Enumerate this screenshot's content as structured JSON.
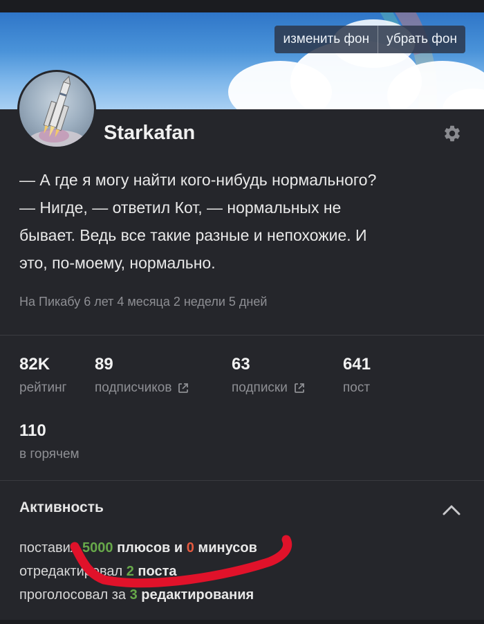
{
  "banner": {
    "change_bg_label": "изменить фон",
    "remove_bg_label": "убрать фон"
  },
  "profile": {
    "username": "Starkafan",
    "bio_lines": [
      "— А где я могу найти кого-нибудь нормального?",
      "— Нигде, — ответил Кот, — нормальных не",
      "бывает. Ведь все такие разные и непохожие. И",
      "это, по-моему, нормально."
    ],
    "member_since": "На Пикабу 6 лет 4 месяца 2 недели 5 дней"
  },
  "stats": [
    {
      "value": "82K",
      "label": "рейтинг"
    },
    {
      "value": "89",
      "label": "подписчиков"
    },
    {
      "value": "63",
      "label": "подписки"
    },
    {
      "value": "641",
      "label": "пост"
    },
    {
      "value": "110",
      "label": "в горячем"
    }
  ],
  "activity": {
    "title": "Активность",
    "line1": {
      "pre": "поставил ",
      "plus_count": "5000",
      "mid": " плюсов и ",
      "minus_count": "0",
      "post": " минусов"
    },
    "line2": {
      "pre": "отредактировал ",
      "count": "2",
      "post": " поста"
    },
    "line3": {
      "pre": "проголосовал за ",
      "count": "3",
      "post": " редактирования"
    }
  },
  "icons": {
    "settings": "gear-icon",
    "external": "external-link-icon",
    "collapse": "chevron-up-icon"
  },
  "colors": {
    "background": "#25262b",
    "accent_green": "#67a84a",
    "accent_red": "#e5593f",
    "scribble": "#e0122a"
  }
}
